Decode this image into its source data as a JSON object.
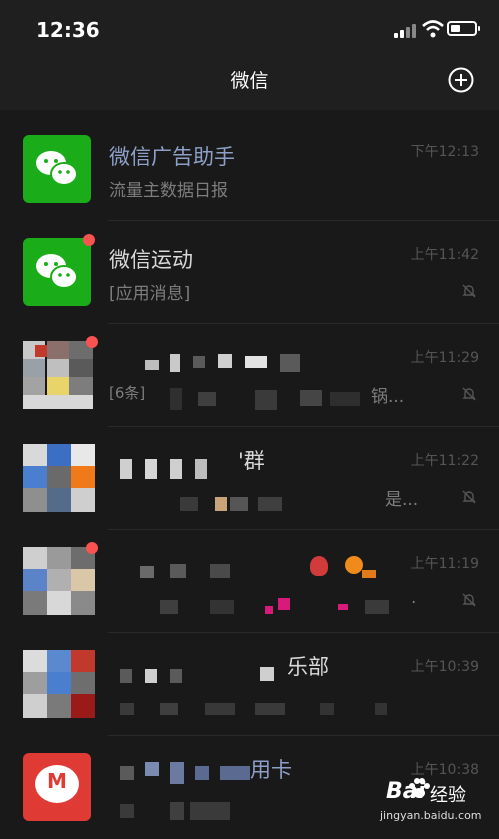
{
  "status_bar": {
    "time": "12:36"
  },
  "nav": {
    "title": "微信"
  },
  "chats": [
    {
      "name": "微信广告助手",
      "message": "流量主数据日报",
      "time": "下午12:13"
    },
    {
      "name": "微信运动",
      "message": "[应用消息]",
      "time": "上午11:42",
      "muted": true,
      "unread_dot": true
    },
    {
      "message_fragment": "[6条]",
      "message_tail": "锅...",
      "time": "上午11:29",
      "muted": true,
      "unread_dot": true
    },
    {
      "name_fragment": "'群",
      "message_tail": "是...",
      "time": "上午11:22",
      "muted": true
    },
    {
      "message_tail": ".",
      "time": "上午11:19",
      "muted": true,
      "unread_dot": true
    },
    {
      "name_fragment": "乐部",
      "time": "上午10:39"
    },
    {
      "name_fragment": "用卡",
      "time": "上午10:38"
    }
  ],
  "watermark": {
    "logo": "Bai",
    "logo_cn": "经验",
    "url": "jingyan.baidu.com"
  },
  "colors": {
    "background": "#191919",
    "bar": "#1f1f1f",
    "wechat_green": "#1aad19",
    "unread_red": "#fa5151",
    "blue_name": "#8ea0c8"
  }
}
